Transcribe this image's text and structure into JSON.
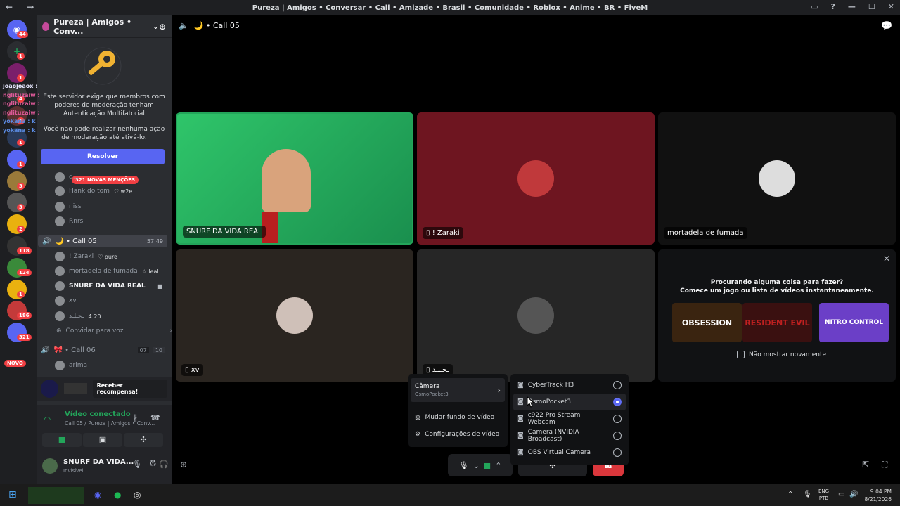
{
  "window": {
    "title": "Pureza | Amigos • Conversar • Call • Amizade • Brasil • Comunidade • Roblox • Anime • BR • FiveM",
    "nav": "← →"
  },
  "guilds": [
    {
      "badge": "44",
      "color": "#5865f2"
    },
    {
      "badge": "1",
      "color": "#2b2d31"
    },
    {
      "badge": "1",
      "color": "#7a1f6b"
    },
    {
      "badge": "4",
      "color": "#3a3a3a"
    },
    {
      "badge": "1",
      "color": "#5a3030"
    },
    {
      "badge": "1",
      "color": "#2a3b5a"
    },
    {
      "badge": "1",
      "color": "#5865f2"
    },
    {
      "badge": "3",
      "color": "#9a7a3a"
    },
    {
      "badge": "3",
      "color": "#555"
    },
    {
      "badge": "2",
      "color": "#e9b10f"
    },
    {
      "badge": "118",
      "color": "#333"
    },
    {
      "badge": "124",
      "color": "#3a8a3a"
    },
    {
      "badge": "1",
      "color": "#e9b10f"
    },
    {
      "badge": "186",
      "color": "#c43a3a"
    },
    {
      "badge": "321",
      "color": "#5865f2"
    }
  ],
  "guild_new": "NOVO",
  "chat_overlay": [
    "joaojoaox :",
    "nglituzaiw :",
    "nglituzaiw :",
    "nglituzaiw :",
    "yokana : k",
    "yokana : k"
  ],
  "server": {
    "name": "Pureza | Amigos • Conv...",
    "chevron": "⌄",
    "invite_icon": "user-plus-icon"
  },
  "mfa": {
    "line1": "Este servidor exige que membros com poderes de moderação tenham Autenticação Multifatorial",
    "line2": "Você não pode realizar nenhuma ação de moderação até ativá-lo.",
    "button": "Resolver"
  },
  "mentions": "321 NOVAS MENÇÕES",
  "prev_members": [
    {
      "name": "d...",
      "tag": ""
    },
    {
      "name": "Hank do tom",
      "tag": "♡ w2e"
    },
    {
      "name": "niss",
      "tag": ""
    },
    {
      "name": "Rnrs",
      "tag": ""
    }
  ],
  "call05": {
    "name": "🌙 • Call 05",
    "time": "57:49"
  },
  "call05_members": [
    {
      "name": "! Zaraki",
      "tag": "♡ pure"
    },
    {
      "name": "mortadela de fumada",
      "tag": "☆ leal"
    },
    {
      "name": "SNURF DA VIDA REAL",
      "tag": ""
    },
    {
      "name": "xv",
      "tag": ""
    },
    {
      "name": "ـﺤـﻠـﺪ",
      "tag": "4:20"
    }
  ],
  "invite_voice": "Convidar para voz",
  "call06": {
    "name": "🎀 • Call 06",
    "count1": "07",
    "count2": "10"
  },
  "call06_members": [
    {
      "name": "arima"
    }
  ],
  "promo": {
    "button": "Receber recompensa!"
  },
  "voice": {
    "status": "Vídeo conectado",
    "channel": "Call 05 / Pureza | Amigos • Conv..."
  },
  "user": {
    "name": "SNURF DA VIDA...",
    "status": "Invisível"
  },
  "header": {
    "channel": "🌙 • Call 05"
  },
  "tiles": [
    {
      "label": "SNURF DA VIDA REAL"
    },
    {
      "label": "! Zaraki"
    },
    {
      "label": "mortadela de fumada"
    },
    {
      "label": "xv"
    },
    {
      "label": "ـﺤـﻠـﺪ"
    }
  ],
  "suggest": {
    "line1": "Procurando alguma coisa para fazer?",
    "line2": "Comece um jogo ou lista de vídeos instantaneamente.",
    "games": [
      "OBSESSION",
      "RESIDENT EVIL",
      "NITRO CONTROL"
    ],
    "checkbox": "Não mostrar novamente"
  },
  "menu": {
    "camera": "Câmera",
    "camera_sub": "OsmoPocket3",
    "background": "Mudar fundo de vídeo",
    "settings": "Configurações de vídeo"
  },
  "cameras": [
    {
      "name": "CyberTrack H3",
      "selected": false
    },
    {
      "name": "OsmoPocket3",
      "selected": true
    },
    {
      "name": "c922 Pro Stream Webcam",
      "selected": false
    },
    {
      "name": "Camera (NVIDIA Broadcast)",
      "selected": false
    },
    {
      "name": "OBS Virtual Camera",
      "selected": false
    }
  ],
  "taskbar": {
    "lang1": "ENG",
    "lang2": "PTB",
    "time": "9:04 PM",
    "date": "8/21/2026"
  }
}
